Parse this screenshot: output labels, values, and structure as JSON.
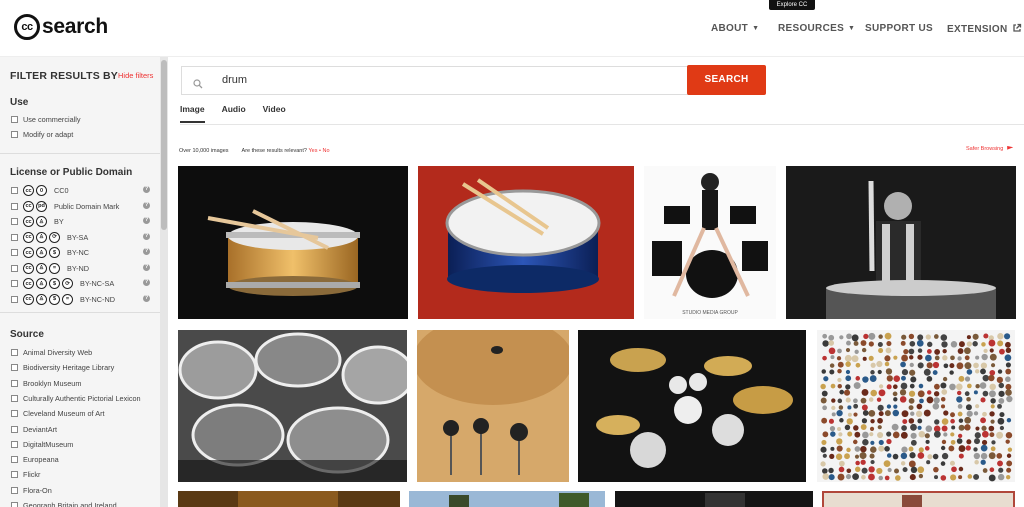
{
  "header": {
    "logo_text": "search",
    "logo_badge": "cc",
    "tooltip": "Explore CC",
    "nav": [
      {
        "label": "ABOUT"
      },
      {
        "label": "RESOURCES"
      },
      {
        "label": "SUPPORT US"
      },
      {
        "label": "EXTENSION"
      }
    ]
  },
  "sidebar": {
    "title": "FILTER RESULTS BY",
    "hide_filters": "Hide filters",
    "use": {
      "title": "Use",
      "options": [
        "Use commercially",
        "Modify or adapt"
      ]
    },
    "license": {
      "title": "License or Public Domain",
      "options": [
        {
          "label": "CC0",
          "icons": [
            "cc",
            "0"
          ]
        },
        {
          "label": "Public Domain Mark",
          "icons": [
            "cc",
            "pd"
          ]
        },
        {
          "label": "BY",
          "icons": [
            "cc",
            "by"
          ]
        },
        {
          "label": "BY-SA",
          "icons": [
            "cc",
            "by",
            "sa"
          ]
        },
        {
          "label": "BY-NC",
          "icons": [
            "cc",
            "by",
            "nc"
          ]
        },
        {
          "label": "BY-ND",
          "icons": [
            "cc",
            "by",
            "nd"
          ]
        },
        {
          "label": "BY-NC-SA",
          "icons": [
            "cc",
            "by",
            "nc",
            "sa"
          ]
        },
        {
          "label": "BY-NC-ND",
          "icons": [
            "cc",
            "by",
            "nc",
            "nd"
          ]
        }
      ]
    },
    "source": {
      "title": "Source",
      "options": [
        "Animal Diversity Web",
        "Biodiversity Heritage Library",
        "Brooklyn Museum",
        "Culturally Authentic Pictorial Lexicon",
        "Cleveland Museum of Art",
        "DeviantArt",
        "DigitaltMuseum",
        "Europeana",
        "Flickr",
        "Flora-On",
        "Geograph Britain and Ireland"
      ]
    }
  },
  "search": {
    "query": "drum",
    "button": "SEARCH"
  },
  "tabs": [
    "Image",
    "Audio",
    "Video"
  ],
  "results": {
    "count": "Over 10,000 images",
    "relevant_q": "Are these results relevant?",
    "yes": "Yes",
    "sep": "•",
    "no": "No",
    "safer": "Safer Browsing"
  },
  "images": [
    {
      "name": "snare-drum-wood"
    },
    {
      "name": "snare-drum-blue"
    },
    {
      "name": "woman-drum-kit"
    },
    {
      "name": "taiko-drummer"
    },
    {
      "name": "stacked-drums-bw"
    },
    {
      "name": "cymbal-mallets"
    },
    {
      "name": "drum-kit-dark"
    },
    {
      "name": "collage-drums"
    },
    {
      "name": "partial-1"
    },
    {
      "name": "partial-2"
    },
    {
      "name": "partial-3"
    },
    {
      "name": "partial-4"
    }
  ],
  "watermark": "STUDIO MEDIA GROUP"
}
